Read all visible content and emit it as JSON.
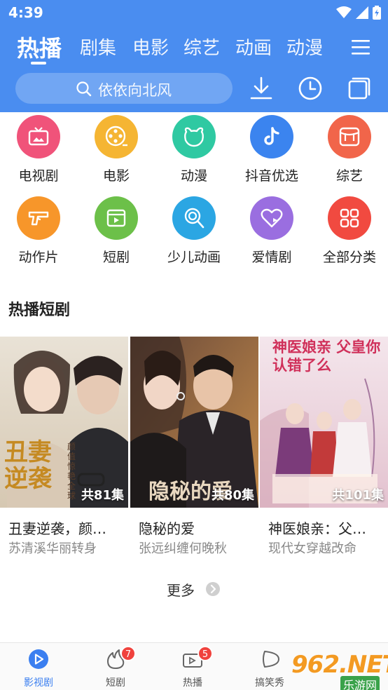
{
  "status_bar": {
    "time": "4:39"
  },
  "tabs": [
    {
      "label": "热播",
      "active": true
    },
    {
      "label": "剧集"
    },
    {
      "label": "电影"
    },
    {
      "label": "综艺"
    },
    {
      "label": "动画"
    },
    {
      "label": "动漫"
    }
  ],
  "search": {
    "placeholder": "依依向北风"
  },
  "categories": [
    {
      "label": "电视剧",
      "color": "#f0537a",
      "icon": "tv-icon"
    },
    {
      "label": "电影",
      "color": "#f5b533",
      "icon": "film-reel-icon"
    },
    {
      "label": "动漫",
      "color": "#2fc9a2",
      "icon": "bear-icon"
    },
    {
      "label": "抖音优选",
      "color": "#3b84ef",
      "icon": "tiktok-icon"
    },
    {
      "label": "综艺",
      "color": "#f1654a",
      "icon": "variety-icon"
    },
    {
      "label": "动作片",
      "color": "#f7962a",
      "icon": "gun-icon"
    },
    {
      "label": "短剧",
      "color": "#6cc049",
      "icon": "video-clip-icon"
    },
    {
      "label": "少儿动画",
      "color": "#2ba6e3",
      "icon": "lollipop-icon"
    },
    {
      "label": "爱情剧",
      "color": "#9a6ee0",
      "icon": "heart-play-icon"
    },
    {
      "label": "全部分类",
      "color": "#f14a40",
      "icon": "grid-icon"
    }
  ],
  "section": {
    "title": "热播短剧"
  },
  "cards": [
    {
      "title": "丑妻逆袭，颜…",
      "subtitle": "苏清溪华丽转身",
      "episodes": "共81集",
      "poster_text": "丑妻逆袭",
      "poster_sub": "颜值惊艳全球"
    },
    {
      "title": "隐秘的爱",
      "subtitle": "张远纠缠何晚秋",
      "episodes": "共80集",
      "poster_text": "隐秘的爱"
    },
    {
      "title": "神医娘亲：父…",
      "subtitle": "现代女穿越改命",
      "episodes": "共101集",
      "poster_text": "神医娘亲 父皇你认错了么"
    }
  ],
  "more": {
    "label": "更多"
  },
  "bottom_nav": [
    {
      "label": "影视剧",
      "active": true
    },
    {
      "label": "短剧",
      "badge": "7"
    },
    {
      "label": "热播",
      "badge": "5"
    },
    {
      "label": "搞笑秀"
    }
  ],
  "watermark": {
    "text": "962.NET",
    "sub": "乐游网"
  },
  "colors": {
    "header": "#4a8df0",
    "accent": "#3b7ff0",
    "badge": "#f0423d"
  }
}
